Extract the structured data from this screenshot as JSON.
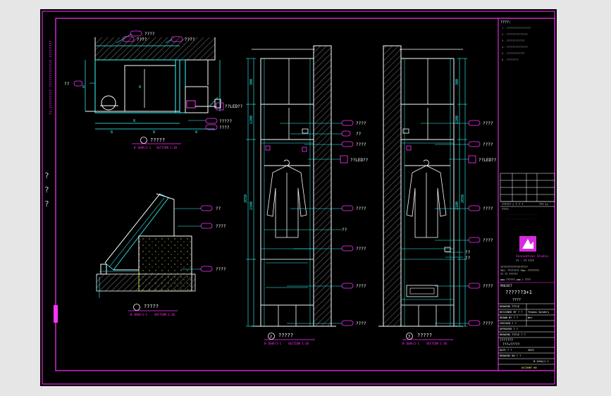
{
  "colors": {
    "background": "#000000",
    "frame": "#ff33ff",
    "dimension": "#33ffff",
    "wall": "#ffffff",
    "hatch": "#777777",
    "fill": "#ffff66",
    "logo": "#d62be0"
  },
  "side_marks": [
    "?",
    "?",
    "?"
  ],
  "left_vertical_note": "??:????????? ????????????? ????????",
  "plan": {
    "callouts": [
      "????",
      "????",
      "????",
      "??",
      "??LED??",
      "?????",
      "????"
    ],
    "dims": [
      "8",
      "8",
      "8",
      "8",
      "8",
      "8"
    ],
    "title": "?????",
    "ref": "B-104A/1-1",
    "scale": "SECTION 1:10"
  },
  "detail": {
    "callouts": [
      "??",
      "????",
      "????"
    ],
    "title": "?????",
    "ref": "B-104A/1-1",
    "scale": "SECTION 1:10"
  },
  "elev1": {
    "callouts": [
      "????",
      "??",
      "????",
      "??LED??",
      "????",
      "??",
      "????",
      "????",
      "????"
    ],
    "dims": [
      "2650",
      "2100",
      "1200",
      "300"
    ],
    "title": "?????",
    "ref": "B-104A/1-1",
    "scale": "SECTION 1:10",
    "num": "2"
  },
  "elev2": {
    "callouts": [
      "????",
      "????",
      "??LED??",
      "????",
      "????",
      "??",
      "??",
      "????",
      "????"
    ],
    "dims": [
      "2650",
      "2100",
      "1200",
      "300"
    ],
    "title": "?????",
    "ref": "B-104A/1-1",
    "scale": "SECTION 1:10",
    "num": "3"
  },
  "titleblock": {
    "notes_title": "????:",
    "notes": [
      "1. ????????????????",
      "2. ??????????????",
      "3. ????????????",
      "4. ??????????????",
      "5. ????????????",
      "6. ????????"
    ],
    "revision": "?????? / ? ? ?",
    "scale_label": "??? 1/",
    "approval": "????:",
    "company": "Innovation Studio",
    "company_sub": "?? · ?? ????",
    "address": [
      "???????????????????",
      "Tel: ????????  Fax: ????????",
      "?? ?? ??????"
    ],
    "web": "www.??????.com / ????",
    "project_label": "PROJECT",
    "project_name": "??????3+1",
    "project_sub": "????",
    "rows": [
      [
        "DRAWING TITLE",
        ""
      ],
      [
        "DESIGNED BY ? ?",
        "Thomas Sanders"
      ],
      [
        "DRAWN BY ? ?",
        "Wei"
      ],
      [
        "CHECKED ? ?",
        ""
      ],
      [
        "APPROVED ? ?",
        ""
      ],
      [
        "DRAWING TITLE ? ?",
        ""
      ]
    ],
    "drawing_title": "???????",
    "drawing_no_value": "???+?????",
    "date_label": "DATE ? ?",
    "date_value": "2015",
    "sheet_label": "DRAWING NO ? ?",
    "sheet_value": "B-104A/1-1",
    "bottom_label": "ACCOUNT NO"
  }
}
